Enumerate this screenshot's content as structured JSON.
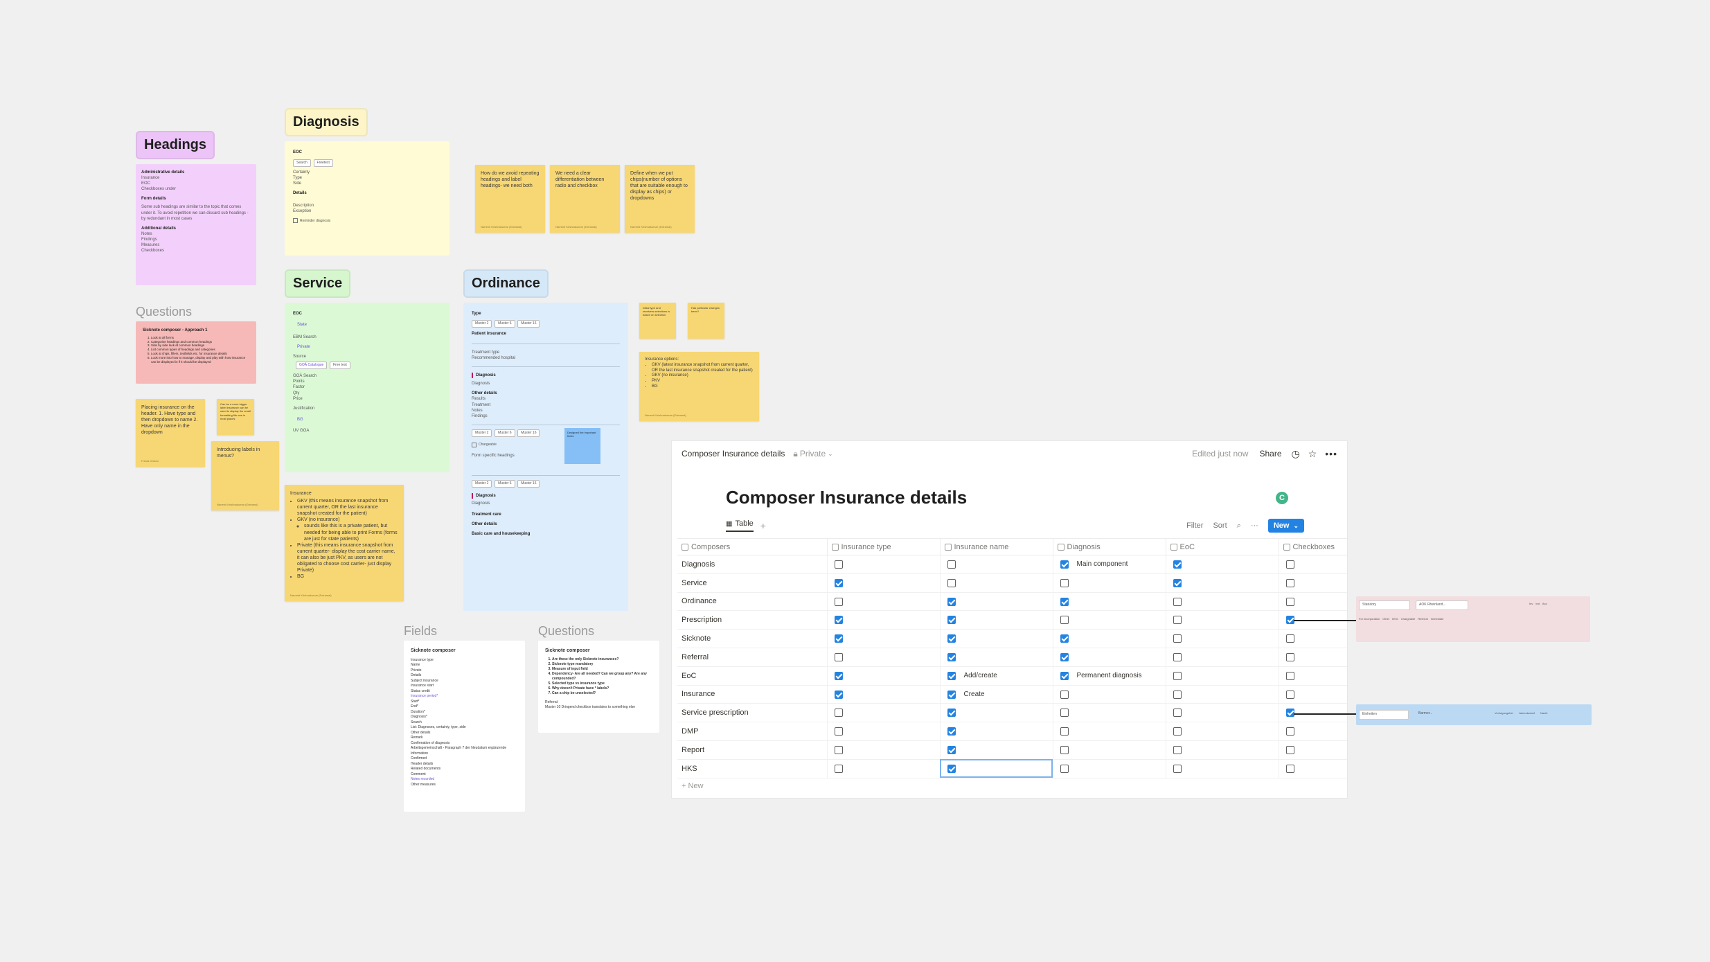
{
  "headings": {
    "title": "Headings",
    "admin_title": "Administrative details",
    "admin_items": [
      "Insurance",
      "EOC",
      "Checkboxes under"
    ],
    "form_title": "Form details",
    "form_note": "Some sub headings are similar to the topic that comes under it. To avoid repetition we can discard sub headings - by redundant in most cases",
    "additional_title": "Additional details",
    "additional_items": [
      "Notes",
      "Findings",
      "Measures",
      "Checkboxes"
    ]
  },
  "diagnosis": {
    "title": "Diagnosis",
    "eoc": "EOC",
    "chips": [
      "Search",
      "Freetext"
    ],
    "items": [
      "Certainty",
      "Type",
      "Side"
    ],
    "details": "Details",
    "details_items": [
      "Description",
      "Exception"
    ],
    "checkbox": "Reminder diagnosis"
  },
  "stickies_top": [
    {
      "text": "How do we avoid repeating headings and label headings- we need both",
      "foot": "Narrenti Krishnakumar (Extramal)"
    },
    {
      "text": "We need a clear differentiation between radio and checkbox",
      "foot": "Narrenti Krishnakumar (Extramal)"
    },
    {
      "text": "Define when we put chips(number of options that are suitable enough to display as chips) or dropdowns",
      "foot": "Narrenti Krishnakumar (Extramal)"
    }
  ],
  "service": {
    "title": "Service",
    "eoc": "EOC",
    "state": "State",
    "ebm": "EBM Search",
    "private": "Private",
    "source": "Source",
    "goa_cat": "GOÄ Catalogue",
    "free": "Free text",
    "goa_search": "GOÄ Search",
    "fields": [
      "Points",
      "Factor",
      "Qty",
      "Price"
    ],
    "justification": "Justification",
    "bg": "BG",
    "uv": "UV GOA"
  },
  "ordinance": {
    "title": "Ordinance",
    "type": "Type",
    "chips1": [
      "Muster 2",
      "Muster 6",
      "Muster 16"
    ],
    "patient_insurance": "Patient insurance",
    "treatment": [
      "Treatment type",
      "Recommended hospital"
    ],
    "diagnosis": "Diagnosis",
    "diagnosis_sub": "Diagnosis",
    "other": "Other details",
    "other_items": [
      "Results",
      "Treatment",
      "Notes",
      "Findings"
    ],
    "chips2": [
      "Muster 2",
      "Muster 6",
      "Muster 16"
    ],
    "chargeable": "Chargeable",
    "form_specific": "Form specific headings",
    "blue_note": "Designed the important fields",
    "chips3": [
      "Muster 2",
      "Muster 6",
      "Muster 16"
    ],
    "bottom": [
      "Diagnosis",
      "Diagnosis",
      "Treatment care",
      "Other details",
      "Basic care and housekeeping"
    ]
  },
  "insurance_sticky": {
    "title": "Insurance",
    "items": [
      "GKV (this means insurance snapshot from current quarter, OR the last insurance snapshot created for the patient)",
      "GKV (no insurance)",
      "Private (this means insurance snapshot from current quarter- display the cost carrier name, it can also be just PKV, as users are not obligated to choose cost carrier- just display Private)",
      "BG"
    ],
    "sub": "sounds like this is a private patient, but needed for being able to print Forms (forms are just for state patients)",
    "foot": "Narrenti Krishnakumar (Extramal)"
  },
  "insurance_options": {
    "title": "Insurance options:",
    "items": [
      "GKV (latest insurance snapshot from current quarter, OR the last insurance snapshot created for the patient)",
      "GKV (no insurance)",
      "PKV",
      "BG"
    ],
    "foot": "Narrenti Krishnakumar (Extramal)"
  },
  "small_stickies": [
    {
      "text": "Initial type and receivers selections is based on selection"
    },
    {
      "text": "Has particular changes been?"
    }
  ],
  "questions_left": {
    "label": "Questions",
    "card_title": "Sicknote composer - Approach 1",
    "card_items": [
      "Look at all forms",
      "Categorise headings and common headings",
      "Side by side look at common headings",
      "List common types of headings and categories",
      "Look at chips, fillers, textfields etc. for insurance details",
      "Look more into how to manage, display and play with how insurance can be displayed in if it should be displayed"
    ],
    "sticky1": "Placing insurance on the header. 1. Have type and then dropdown to name 2. Have only name in the dropdown",
    "sticky1_foot": "Frieda Ohlsen",
    "sticky2": "Can be a more bigger label insurance can be used to display the small formatting fits one in most places",
    "sticky3": "Introducing labels in menus?",
    "sticky3_foot": "Narrenti Krishnakumar (Extramal)"
  },
  "fields": {
    "label": "Fields",
    "title": "Sicknote composer",
    "lines": [
      "Insurance type",
      "Name",
      "Private",
      "Details",
      "Subject insurance",
      "Insurance start",
      "Status credit",
      "Insurance period*",
      "Start*",
      "End*",
      "Duration*",
      "Diagnosis*",
      "Search",
      "List: Diagnoses, certainty, type, side",
      "Other details",
      "Remark",
      "Confirmation of diagnosis",
      "Arbeitsgemeinschaft - Paragraph 7 der Neudatum ergänzende Information",
      "Confirmed",
      "Header details",
      "Related documents",
      "Comment",
      "Notes recorded",
      "Other measures"
    ]
  },
  "questions_right": {
    "label": "Questions",
    "title": "Sicknote composer",
    "items": [
      "Are these the only Sicknote insurances?",
      "Sicknote type mandatory",
      "Measure of input field",
      "Dependency- Are all needed? Can we group any? Are any compounded?",
      "Selected type vs insurance type",
      "Why doesn't Private have * labels?",
      "Can a chip be unselected?"
    ],
    "referral": "Referral:",
    "referral_note": "Muster 10 Dringend checkbox translates to something else"
  },
  "notion": {
    "breadcrumb": "Composer Insurance details",
    "privacy": "Private",
    "edited": "Edited just now",
    "share": "Share",
    "page_title": "Composer Insurance details",
    "avatar": "C",
    "view_tab": "Table",
    "add_view": "+",
    "filter": "Filter",
    "sort": "Sort",
    "new_button": "New",
    "columns": [
      "Composers",
      "Insurance type",
      "Insurance name",
      "Diagnosis",
      "EoC",
      "Checkboxes"
    ],
    "rows": [
      {
        "name": "Diagnosis",
        "c1": false,
        "c2": false,
        "c3": true,
        "c3text": "Main component",
        "c4": true,
        "c5": false,
        "c2text": ""
      },
      {
        "name": "Service",
        "c1": true,
        "c2": false,
        "c3": false,
        "c3text": "",
        "c4": true,
        "c5": false,
        "c2text": ""
      },
      {
        "name": "Ordinance",
        "c1": false,
        "c2": true,
        "c3": true,
        "c3text": "",
        "c4": false,
        "c5": false,
        "c2text": ""
      },
      {
        "name": "Prescription",
        "c1": true,
        "c2": true,
        "c3": false,
        "c3text": "",
        "c4": false,
        "c5": true,
        "c2text": ""
      },
      {
        "name": "Sicknote",
        "c1": true,
        "c2": true,
        "c3": true,
        "c3text": "",
        "c4": false,
        "c5": false,
        "c2text": ""
      },
      {
        "name": "Referral",
        "c1": false,
        "c2": true,
        "c3": true,
        "c3text": "",
        "c4": false,
        "c5": false,
        "c2text": ""
      },
      {
        "name": "EoC",
        "c1": true,
        "c2": true,
        "c3": true,
        "c3text": "Permanent diagnosis",
        "c4": false,
        "c5": false,
        "c2text": "Add/create"
      },
      {
        "name": "Insurance",
        "c1": true,
        "c2": true,
        "c3": false,
        "c3text": "",
        "c4": false,
        "c5": false,
        "c2text": "Create"
      },
      {
        "name": "Service prescription",
        "c1": false,
        "c2": true,
        "c3": false,
        "c3text": "",
        "c4": false,
        "c5": true,
        "c2text": ""
      },
      {
        "name": "DMP",
        "c1": false,
        "c2": true,
        "c3": false,
        "c3text": "",
        "c4": false,
        "c5": false,
        "c2text": ""
      },
      {
        "name": "Report",
        "c1": false,
        "c2": true,
        "c3": false,
        "c3text": "",
        "c4": false,
        "c5": false,
        "c2text": ""
      },
      {
        "name": "HKS",
        "c1": false,
        "c2": true,
        "c3": false,
        "c3text": "",
        "c4": false,
        "c5": false,
        "c2text": ""
      }
    ],
    "new_row": "+ New"
  },
  "component_bars": {
    "bar1": {
      "input1": "Statutory",
      "input2": "AOK Rheinland...",
      "opts_right": [
        "Inv",
        "Ind",
        "Acc"
      ],
      "opts_bottom": [
        "For incorporation",
        "Other",
        "BVG",
        "Chargeable",
        "Referral",
        "Immediate"
      ]
    },
    "bar2": {
      "input1": "Einheiten",
      "input2": "Barmer...",
      "opts": [
        "Verfolgungsfrei",
        "Jahresbedarf",
        "Nacht"
      ]
    }
  },
  "colors": {
    "headings_bg": "#f3d0fb",
    "headings_title_bg": "#ecc4f7",
    "diagnosis_bg": "#fffbd4",
    "diagnosis_title_bg": "#fdf5c8",
    "service_bg": "#dcf9d6",
    "service_title_bg": "#d6f6ce",
    "ordinance_bg": "#deedfb",
    "ordinance_title_bg": "#d5e8f8",
    "sticky_yellow": "#f7d774",
    "sticky_pink": "#f6b9b7",
    "accent_blue": "#2383e2"
  }
}
